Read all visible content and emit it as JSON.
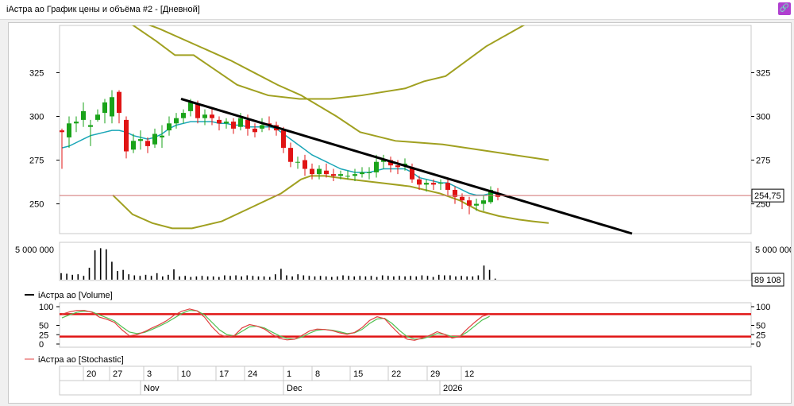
{
  "window": {
    "title": "iАстра ао График цены и объёма #2 - [Дневной]",
    "corner_icon": "link-icon"
  },
  "colors": {
    "bull": "#1aa31a",
    "bear": "#e01414",
    "ma": "#1aa6b7",
    "envelope": "#a0a020",
    "trend": "#000000",
    "stoch_k": "#e04040",
    "stoch_d": "#50c050",
    "level_line": "#e01414",
    "price_line": "#d07070"
  },
  "chart_data": [
    {
      "type": "candlestick",
      "ylim": [
        233,
        352
      ],
      "y_ticks": [
        "250",
        "275",
        "300",
        "325"
      ],
      "last_price_label": "254,75",
      "last_price": 254.75,
      "candles": [
        [
          292,
          291,
          270,
          293
        ],
        [
          288,
          296,
          282,
          300
        ],
        [
          296,
          297,
          291,
          300
        ],
        [
          298,
          303,
          294,
          308
        ],
        [
          294,
          295,
          283,
          298
        ],
        [
          298,
          301,
          297,
          304
        ],
        [
          302,
          308,
          296,
          310
        ],
        [
          300,
          311,
          296,
          315
        ],
        [
          314,
          302,
          296,
          315
        ],
        [
          298,
          280,
          276,
          300
        ],
        [
          281,
          286,
          279,
          290
        ],
        [
          286,
          287,
          281,
          292
        ],
        [
          286,
          283,
          279,
          288
        ],
        [
          284,
          290,
          282,
          293
        ],
        [
          288,
          289,
          282,
          295
        ],
        [
          292,
          296,
          289,
          300
        ],
        [
          296,
          299,
          293,
          302
        ],
        [
          299,
          302,
          296,
          304
        ],
        [
          303,
          308,
          300,
          310
        ],
        [
          307,
          299,
          296,
          309
        ],
        [
          299,
          301,
          295,
          304
        ],
        [
          301,
          299,
          295,
          305
        ],
        [
          298,
          296,
          292,
          300
        ],
        [
          296,
          297,
          293,
          299
        ],
        [
          297,
          293,
          290,
          299
        ],
        [
          294,
          299,
          292,
          302
        ],
        [
          298,
          293,
          289,
          301
        ],
        [
          293,
          291,
          288,
          296
        ],
        [
          293,
          295,
          291,
          299
        ],
        [
          296,
          295,
          292,
          300
        ],
        [
          295,
          292,
          289,
          297
        ],
        [
          292,
          282,
          279,
          294
        ],
        [
          282,
          274,
          271,
          285
        ],
        [
          274,
          274,
          270,
          277
        ],
        [
          275,
          270,
          266,
          278
        ],
        [
          270,
          267,
          264,
          273
        ],
        [
          267,
          270,
          264,
          272
        ],
        [
          269,
          267,
          265,
          273
        ],
        [
          267,
          266,
          263,
          270
        ],
        [
          266,
          267,
          264,
          269
        ],
        [
          266,
          266,
          264,
          269
        ],
        [
          266,
          267,
          263,
          270
        ],
        [
          267,
          268,
          265,
          271
        ],
        [
          268,
          268,
          264,
          271
        ],
        [
          268,
          274,
          265,
          278
        ],
        [
          274,
          275,
          270,
          278
        ],
        [
          275,
          272,
          268,
          277
        ],
        [
          272,
          271,
          267,
          275
        ],
        [
          272,
          273,
          269,
          276
        ],
        [
          271,
          264,
          262,
          273
        ],
        [
          264,
          261,
          258,
          266
        ],
        [
          261,
          262,
          257,
          264
        ],
        [
          262,
          261,
          258,
          264
        ],
        [
          262,
          262,
          258,
          264
        ],
        [
          262,
          258,
          255,
          264
        ],
        [
          258,
          254,
          250,
          260
        ],
        [
          254,
          252,
          247,
          256
        ],
        [
          252,
          249,
          244,
          254
        ],
        [
          249,
          250,
          246,
          253
        ],
        [
          250,
          252,
          246,
          255
        ],
        [
          251,
          258,
          250,
          260
        ],
        [
          256,
          254,
          252,
          259
        ]
      ],
      "ma": [
        282,
        283,
        285,
        287,
        289,
        290,
        291,
        292,
        292,
        291,
        289,
        288,
        287,
        288,
        290,
        293,
        295,
        296,
        297,
        297,
        297,
        297,
        296,
        296,
        295,
        295,
        294,
        294,
        294,
        294,
        293,
        290,
        287,
        284,
        281,
        278,
        276,
        274,
        272,
        270,
        269,
        268,
        268,
        268,
        269,
        270,
        270,
        270,
        270,
        268,
        265,
        264,
        263,
        262,
        262,
        260,
        258,
        256,
        255,
        255,
        256,
        256
      ],
      "envelope": {
        "upper_outer": [
          [
            0,
            360
          ],
          [
            14,
            343
          ],
          [
            20,
            335
          ],
          [
            26,
            335
          ],
          [
            40,
            318
          ],
          [
            50,
            312
          ],
          [
            60,
            310
          ],
          [
            70,
            310
          ],
          [
            80,
            312
          ],
          [
            94,
            316
          ],
          [
            100,
            320
          ],
          [
            107,
            323
          ],
          [
            120,
            340
          ],
          [
            130,
            350
          ],
          [
            140,
            360
          ]
        ],
        "upper_mid": [
          [
            0,
            360
          ],
          [
            20,
            350
          ],
          [
            40,
            338
          ],
          [
            50,
            332
          ],
          [
            60,
            325
          ],
          [
            70,
            318
          ],
          [
            80,
            312
          ],
          [
            95,
            300
          ],
          [
            105,
            291
          ],
          [
            120,
            286
          ],
          [
            140,
            284
          ],
          [
            160,
            280
          ],
          [
            185,
            275
          ]
        ],
        "upper_top": [
          [
            60,
            355
          ],
          [
            65,
            345
          ],
          [
            75,
            335
          ],
          [
            85,
            320
          ],
          [
            95,
            318
          ],
          [
            110,
            318
          ],
          [
            130,
            317
          ],
          [
            150,
            316
          ],
          [
            170,
            314
          ],
          [
            185,
            314
          ]
        ],
        "lower": [
          [
            0,
            255
          ],
          [
            10,
            244
          ],
          [
            20,
            239
          ],
          [
            30,
            236
          ],
          [
            40,
            236
          ],
          [
            55,
            240
          ],
          [
            70,
            248
          ],
          [
            85,
            256
          ],
          [
            95,
            264
          ],
          [
            100,
            266
          ],
          [
            107,
            266
          ],
          [
            120,
            264
          ],
          [
            135,
            262
          ],
          [
            150,
            260
          ],
          [
            165,
            256
          ],
          [
            175,
            252
          ],
          [
            185,
            246
          ],
          [
            195,
            243
          ],
          [
            205,
            241
          ],
          [
            212,
            240
          ],
          [
            220,
            239
          ]
        ]
      },
      "trendline": [
        [
          227,
          310
        ],
        [
          795,
          233
        ]
      ],
      "hline_price": 254.75
    },
    {
      "type": "bar",
      "y_tick_label": "5 000 000",
      "last_value_label": "89 108",
      "legend": "iАстра ао [Volume]",
      "values": [
        1.2,
        1.1,
        0.9,
        1.0,
        0.7,
        2.2,
        5.4,
        5.8,
        5.6,
        3.3,
        1.6,
        1.8,
        1.0,
        0.8,
        0.7,
        0.9,
        0.7,
        1.2,
        0.6,
        0.9,
        1.9,
        0.6,
        0.7,
        0.5,
        0.6,
        0.7,
        0.6,
        0.6,
        0.5,
        0.8,
        0.7,
        0.8,
        0.6,
        0.8,
        0.7,
        0.6,
        0.6,
        0.5,
        1.0,
        2.0,
        0.8,
        0.6,
        1.0,
        0.8,
        0.7,
        0.6,
        0.7,
        0.6,
        0.5,
        0.6,
        0.8,
        0.7,
        0.6,
        0.7,
        0.6,
        0.7,
        0.5,
        0.8,
        0.7,
        0.6,
        0.7,
        0.6,
        0.7,
        0.6,
        0.8,
        0.7,
        0.5,
        0.9,
        0.8,
        0.8,
        0.6,
        0.7,
        0.6,
        0.6,
        0.8,
        2.6,
        1.8,
        0.2
      ]
    },
    {
      "type": "line",
      "y_ticks": [
        "0",
        "25",
        "50",
        "100"
      ],
      "ylim": [
        0,
        100
      ],
      "levels": [
        80,
        20
      ],
      "legend": "iАстра ао [Stochastic]",
      "k": [
        80,
        86,
        90,
        90,
        85,
        72,
        66,
        58,
        38,
        22,
        25,
        33,
        43,
        52,
        63,
        78,
        88,
        94,
        89,
        72,
        46,
        26,
        18,
        23,
        43,
        52,
        48,
        40,
        26,
        15,
        11,
        13,
        23,
        35,
        40,
        39,
        36,
        30,
        26,
        31,
        44,
        63,
        73,
        68,
        46,
        26,
        13,
        10,
        16,
        23,
        33,
        26,
        16,
        20,
        40,
        58,
        74,
        80
      ],
      "d": [
        70,
        78,
        85,
        88,
        86,
        78,
        70,
        62,
        46,
        32,
        28,
        31,
        39,
        48,
        58,
        70,
        82,
        90,
        89,
        78,
        58,
        38,
        25,
        22,
        34,
        46,
        48,
        43,
        32,
        22,
        15,
        13,
        19,
        29,
        37,
        39,
        37,
        33,
        28,
        30,
        39,
        55,
        67,
        69,
        55,
        36,
        20,
        13,
        14,
        20,
        28,
        26,
        20,
        20,
        32,
        48,
        64,
        74
      ]
    }
  ],
  "time_axis": {
    "days": [
      "20",
      "27",
      "3",
      "10",
      "17",
      "24",
      "1",
      "8",
      "15",
      "22",
      "29",
      "12"
    ],
    "months": [
      "Nov",
      "Dec",
      "2026"
    ]
  }
}
